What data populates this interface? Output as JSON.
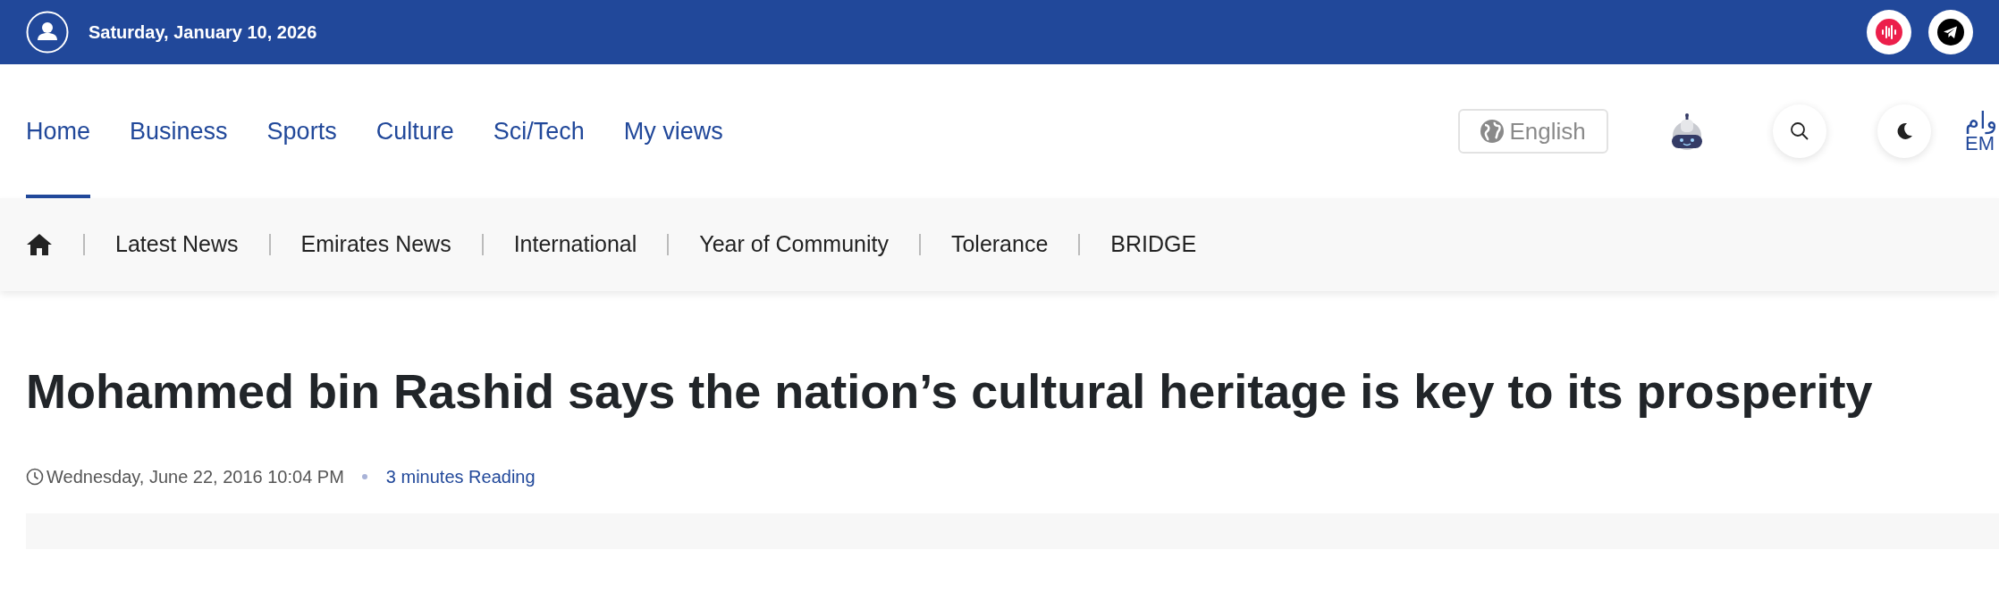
{
  "top_bar": {
    "date": "Saturday, January 10, 2026"
  },
  "main_nav": {
    "items": [
      {
        "label": "Home",
        "selected": true
      },
      {
        "label": "Business",
        "selected": false
      },
      {
        "label": "Sports",
        "selected": false
      },
      {
        "label": "Culture",
        "selected": false
      },
      {
        "label": "Sci/Tech",
        "selected": false
      },
      {
        "label": "My views",
        "selected": false
      }
    ],
    "language": "English",
    "logo": {
      "arabic": "وام",
      "latin": "EM"
    }
  },
  "sub_nav": {
    "items": [
      "Latest News",
      "Emirates News",
      "International",
      "Year of Community",
      "Tolerance",
      "BRIDGE"
    ]
  },
  "article": {
    "title": "Mohammed bin Rashid says the nation’s cultural heritage is key to its prosperity",
    "date": "Wednesday, June 22, 2016 10:04 PM",
    "reading_time": "3 minutes Reading"
  }
}
